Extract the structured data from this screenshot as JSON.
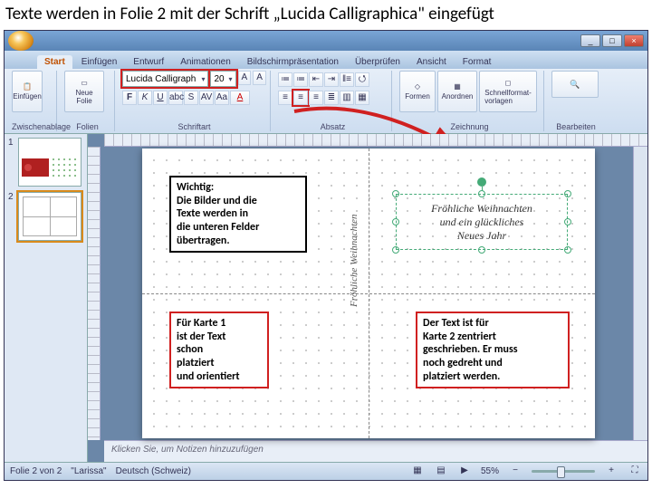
{
  "page_title": "Texte werden in Folie 2 mit der Schrift „Lucida Calligraphica\" eingefügt",
  "tabs": {
    "start": "Start",
    "einfuegen": "Einfügen",
    "entwurf": "Entwurf",
    "animationen": "Animationen",
    "bildschirm": "Bildschirmpräsentation",
    "ueberpruefen": "Überprüfen",
    "ansicht": "Ansicht",
    "format": "Format"
  },
  "ribbon": {
    "paste_label": "Einfügen",
    "zwischenablage": "Zwischenablage",
    "neue_folie": "Neue\nFolie",
    "folien": "Folien",
    "font_name": "Lucida Calligraph",
    "font_size": "20",
    "schriftart": "Schriftart",
    "absatz": "Absatz",
    "formen": "Formen",
    "anordnen": "Anordnen",
    "schnellformat": "Schnellformat-\nvorlagen",
    "zeichnung": "Zeichnung",
    "bearbeiten": "Bearbeiten"
  },
  "thumbs": {
    "n1": "1",
    "n2": "2"
  },
  "annotations": {
    "wichtig": "Wichtig:\nDie Bilder und die\nTexte werden in\ndie unteren Felder\nübertragen.",
    "karte1": "Für Karte 1\nist der Text\nschon\nplatziert\nund orientiert",
    "karte2": "Der Text ist für\nKarte 2 zentriert\ngeschrieben. Er muss\nnoch gedreht und\nplatziert werden."
  },
  "textbox": {
    "l1": "Fröhliche Weihnachten",
    "l2": "und ein glückliches",
    "l3": "Neues Jahr"
  },
  "rotated_text": "Fröhliche Weihnachten",
  "notes_placeholder": "Klicken Sie, um Notizen hinzuzufügen",
  "status": {
    "slide": "Folie 2 von 2",
    "theme": "\"Larissa\"",
    "lang": "Deutsch (Schweiz)",
    "zoom": "55%"
  }
}
